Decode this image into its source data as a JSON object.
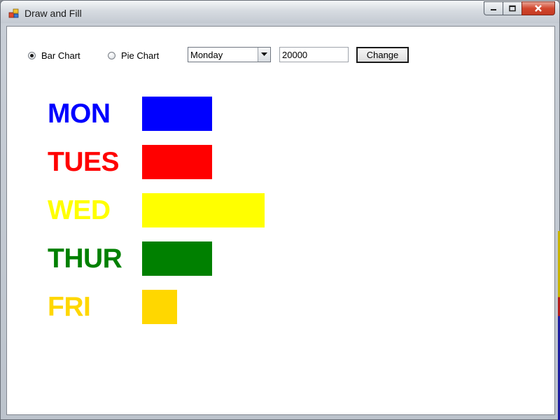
{
  "window": {
    "title": "Draw and Fill"
  },
  "controls": {
    "bar_chart_label": "Bar Chart",
    "pie_chart_label": "Pie Chart",
    "selected_chart": "bar",
    "day_select_value": "Monday",
    "value_input": "20000",
    "change_button": "Change"
  },
  "chart_data": {
    "type": "bar",
    "categories": [
      "MON",
      "TUES",
      "WED",
      "THUR",
      "FRI"
    ],
    "values": [
      20000,
      20000,
      35000,
      20000,
      10000
    ],
    "colors": [
      "#0000ff",
      "#ff0000",
      "#ffff00",
      "#008000",
      "#ffd700"
    ]
  }
}
